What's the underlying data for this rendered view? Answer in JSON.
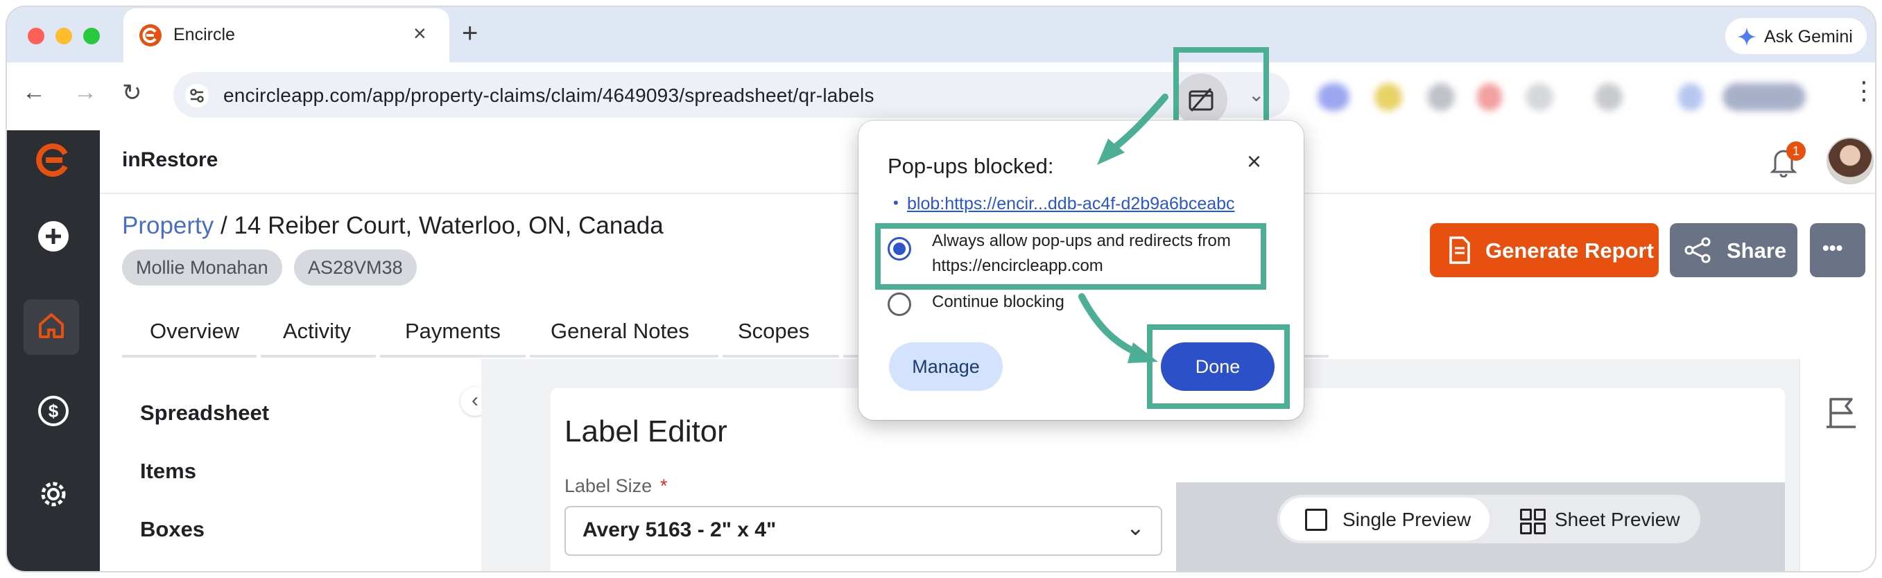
{
  "browser": {
    "tab_title": "Encircle",
    "tab_close": "×",
    "new_tab": "+",
    "gemini_label": "Ask Gemini",
    "url": "encircleapp.com/app/property-claims/claim/4649093/spreadsheet/qr-labels"
  },
  "app": {
    "brand": "inRestore",
    "notification_count": "1",
    "breadcrumb": {
      "link": "Property",
      "separator": " / ",
      "address": "14 Reiber Court, Waterloo, ON, Canada"
    },
    "chips": [
      "Mollie Monahan",
      "AS28VM38"
    ],
    "actions": {
      "generate_report": "Generate Report",
      "share": "Share",
      "more": "•••"
    },
    "tabs": [
      "Overview",
      "Activity",
      "Payments",
      "General Notes",
      "Scopes"
    ],
    "sidebar": [
      "Spreadsheet",
      "Items",
      "Boxes"
    ],
    "collapse_glyph": "‹",
    "label_editor": {
      "title": "Label Editor",
      "size_label": "Label Size",
      "required_mark": "*",
      "size_value": "Avery 5163 - 2\" x 4\"",
      "preview_single": "Single Preview",
      "preview_sheet": "Sheet Preview"
    }
  },
  "popup": {
    "title": "Pop-ups blocked:",
    "close": "×",
    "link": "blob:https://encir...ddb-ac4f-d2b9a6bceabc",
    "option_allow_line1": "Always allow pop-ups and redirects from",
    "option_allow_line2": "https://encircleapp.com",
    "option_block": "Continue blocking",
    "manage": "Manage",
    "done": "Done"
  },
  "colors": {
    "highlight": "#4caf95",
    "accent_orange": "#e8500f",
    "accent_blue": "#2c50c8",
    "rail": "#2b2e33"
  }
}
